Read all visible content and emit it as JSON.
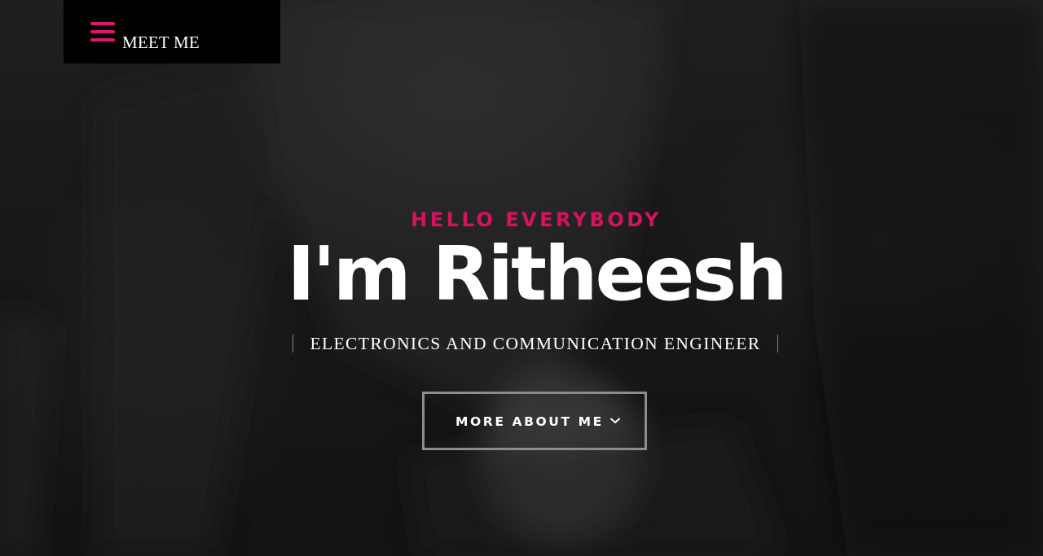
{
  "header": {
    "menu_label": "MEET ME"
  },
  "hero": {
    "greeting": "HELLO EVERYBODY",
    "name": "I'm Ritheesh",
    "role": "ELECTRONICS AND COMMUNICATION ENGINEER",
    "cta_label": "MORE ABOUT ME",
    "cta_icon": "chevron-down-icon"
  },
  "colors": {
    "accent": "#d4135f",
    "menu_background": "#000000",
    "text": "#ffffff"
  }
}
